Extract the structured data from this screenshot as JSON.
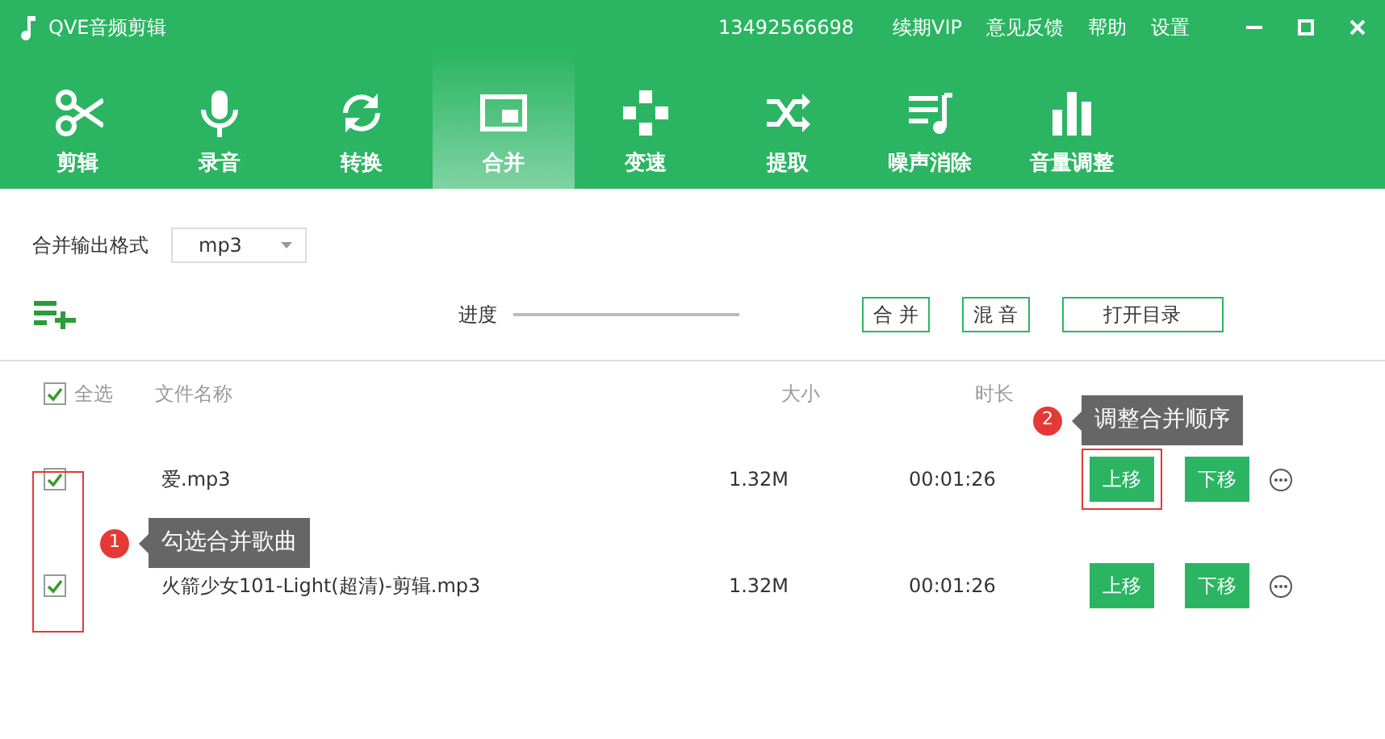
{
  "window": {
    "title": "QVE音频剪辑",
    "phone": "13492566698",
    "menu": [
      "续期VIP",
      "意见反馈",
      "帮助",
      "设置"
    ]
  },
  "tabs": [
    {
      "label": "剪辑",
      "selected": false
    },
    {
      "label": "录音",
      "selected": false
    },
    {
      "label": "转换",
      "selected": false
    },
    {
      "label": "合并",
      "selected": true
    },
    {
      "label": "变速",
      "selected": false
    },
    {
      "label": "提取",
      "selected": false
    },
    {
      "label": "噪声消除",
      "selected": false
    },
    {
      "label": "音量调整",
      "selected": false
    }
  ],
  "format": {
    "label": "合并输出格式",
    "value": "mp3"
  },
  "progress": {
    "label": "进度"
  },
  "actions": [
    "合 并",
    "混 音",
    "打开目录"
  ],
  "table": {
    "select_all": {
      "label": "全选",
      "checked": true
    },
    "columns": [
      "文件名称",
      "大小",
      "时长"
    ],
    "rows": [
      {
        "checked": true,
        "name": "爱.mp3",
        "size": "1.32M",
        "duration": "00:01:26",
        "up": "上移",
        "down": "下移",
        "highlighted": true
      },
      {
        "checked": true,
        "name": "火箭少女101-Light(超清)-剪辑.mp3",
        "size": "1.32M",
        "duration": "00:01:26",
        "up": "上移",
        "down": "下移",
        "highlighted": false
      }
    ]
  },
  "annotations": [
    {
      "number": "1",
      "text": "勾选合并歌曲"
    },
    {
      "number": "2",
      "text": "调整合并顺序"
    }
  ]
}
